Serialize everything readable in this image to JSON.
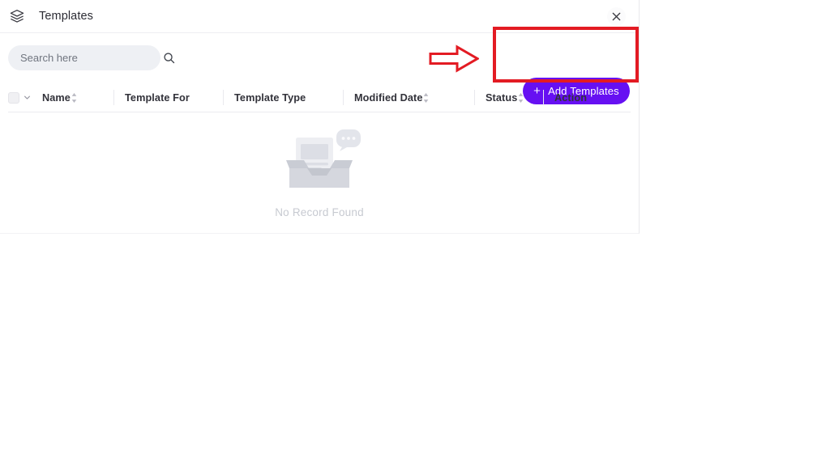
{
  "window": {
    "title": "Templates",
    "title_icon": "layers-icon",
    "close_icon": "close-icon"
  },
  "toolbar": {
    "search": {
      "placeholder": "Search here",
      "value": "",
      "icon": "search-icon"
    },
    "add_button": {
      "label": "Add Templates",
      "plus": "+",
      "color": "#6610f2",
      "text_color": "#ffffff"
    }
  },
  "annotations": {
    "arrow": {
      "name": "red-arrow-annotation",
      "direction": "right",
      "color": "#e31b23"
    },
    "highlight": {
      "name": "red-highlight-rectangle",
      "target": "add-templates-button",
      "color": "#e31b23"
    }
  },
  "table": {
    "select_all": {
      "checked": false,
      "chevron_icon": "chevron-down-icon"
    },
    "columns": [
      {
        "label": "Name",
        "sortable": true,
        "sort_icon": "sort-icon"
      },
      {
        "label": "Template For",
        "sortable": false,
        "sort_icon": ""
      },
      {
        "label": "Template Type",
        "sortable": false,
        "sort_icon": ""
      },
      {
        "label": "Modified Date",
        "sortable": true,
        "sort_icon": "sort-icon"
      },
      {
        "label": "Status",
        "sortable": true,
        "sort_icon": "sort-icon"
      },
      {
        "label": "Action",
        "sortable": false,
        "sort_icon": ""
      }
    ],
    "rows": [],
    "empty_state": {
      "message": "No Record Found",
      "illustration": "empty-box-illustration",
      "bubble_icon": "speech-bubble-icon"
    }
  },
  "colors": {
    "accent": "#6610f2",
    "annotation": "#e31b23",
    "search_bg": "#eef0f4",
    "empty_text": "#c7cad1",
    "title_text": "#2b2b33"
  }
}
